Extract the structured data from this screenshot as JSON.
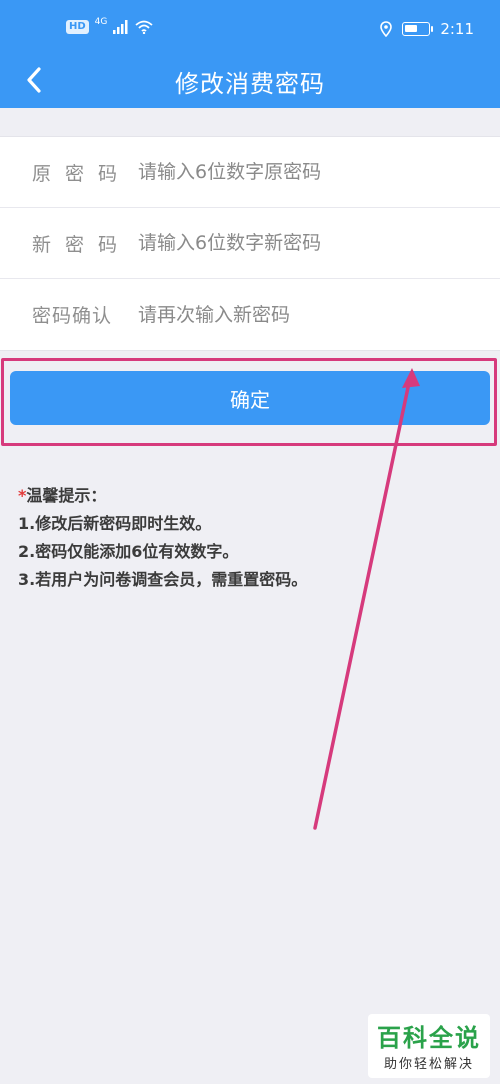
{
  "status_bar": {
    "hd": "HD",
    "network": "4G",
    "time": "2:11"
  },
  "nav": {
    "title": "修改消费密码"
  },
  "form": {
    "fields": [
      {
        "label": "原密码",
        "placeholder": "请输入6位数字原密码",
        "value": ""
      },
      {
        "label": "新密码",
        "placeholder": "请输入6位数字新密码",
        "value": ""
      },
      {
        "label": "密码确认",
        "placeholder": "请再次输入新密码",
        "value": ""
      }
    ],
    "submit_label": "确定"
  },
  "tips": {
    "star": "*",
    "heading": "温馨提示：",
    "items": [
      "1.修改后新密码即时生效。",
      "2.密码仅能添加6位有效数字。",
      "3.若用户为问卷调查会员，需重置密码。"
    ]
  },
  "watermark": {
    "main": "百科全说",
    "sub": "助你轻松解决"
  },
  "colors": {
    "primary": "#3a98f5",
    "annotation": "#d63a7c",
    "watermark_green": "#2aa24a"
  }
}
